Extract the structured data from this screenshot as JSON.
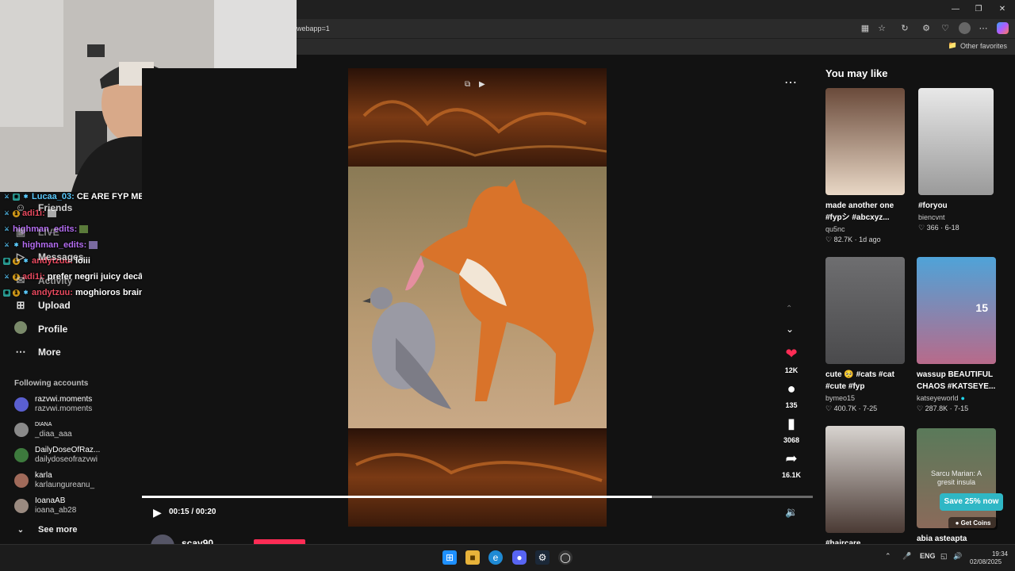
{
  "browser": {
    "address": "webapp=1",
    "other_favorites": "Other favorites"
  },
  "chat": [
    {
      "user": "Lucaa_03:",
      "text": "CE ARE FYP MEU",
      "user_color": "#5ac8fa"
    },
    {
      "user": "adi1i:",
      "text": "",
      "user_color": "#e84a5f"
    },
    {
      "user": "highman_edits:",
      "text": "",
      "user_color": "#b36cf0"
    },
    {
      "user": "highman_edits:",
      "text": "",
      "user_color": "#b36cf0"
    },
    {
      "user": "andytzuu:",
      "text": "loiii",
      "user_color": "#e84a5f"
    },
    {
      "user": "adi1i:",
      "text": "prefer negrii juicy decât asta",
      "user_color": "#e84a5f"
    },
    {
      "user": "andytzuu:",
      "text": "moghioros brainrot",
      "user_color": "#e84a5f"
    }
  ],
  "sidebar": {
    "nav": [
      {
        "label": "Friends",
        "icon": "friends-icon"
      },
      {
        "label": "LIVE",
        "icon": "live-icon"
      },
      {
        "label": "Messages",
        "icon": "messages-icon"
      },
      {
        "label": "Activity",
        "icon": "activity-icon"
      },
      {
        "label": "Upload",
        "icon": "upload-icon"
      },
      {
        "label": "Profile",
        "icon": "profile-avatar"
      },
      {
        "label": "More",
        "icon": "more-icon"
      }
    ],
    "following_title": "Following accounts",
    "following": [
      {
        "name": "razvwi.moments",
        "handle": "razvwi.moments",
        "color": "#5a5fd0"
      },
      {
        "name": "DIANA",
        "handle": "_diaa_aaa",
        "color": "#8a8a8a"
      },
      {
        "name": "DailyDoseOfRaz...",
        "handle": "dailydoseofrazvwi",
        "color": "#3d7a3d"
      },
      {
        "name": "karla",
        "handle": "karlaungureanu_",
        "color": "#a06a5a"
      },
      {
        "name": "IoanaAB",
        "handle": "ioana_ab28",
        "color": "#9a8a80"
      }
    ],
    "see_more": "See more"
  },
  "player": {
    "time": "00:15 / 00:20",
    "progress": 0.76,
    "author_partial": "scav90",
    "actions": [
      {
        "icon": "heart-icon",
        "count": "12K",
        "color": "#fe2c55"
      },
      {
        "icon": "comment-icon",
        "count": "135",
        "color": "#ffffff"
      },
      {
        "icon": "bookmark-icon",
        "count": "3068",
        "color": "#ffffff"
      },
      {
        "icon": "share-icon",
        "count": "16.1K",
        "color": "#ffffff"
      }
    ]
  },
  "recommendations": {
    "title": "You may like",
    "cards": [
      {
        "title": "made another one #fypシ #abcxyz...",
        "author": "qu5nc",
        "likes": "82.7K",
        "date": "1d ago",
        "verified": false
      },
      {
        "title": "#foryou",
        "author": "biencvnt",
        "likes": "366",
        "date": "6-18",
        "verified": false
      },
      {
        "title": "cute 🥺 #cats #cat #cute #fyp",
        "author": "bymeo15",
        "likes": "400.7K",
        "date": "7-25",
        "verified": false
      },
      {
        "title": "wassup BEAUTIFUL CHAOS #KATSEYE...",
        "author": "katseyeworld",
        "likes": "287.8K",
        "date": "7-15",
        "verified": true
      },
      {
        "title": "#haircare",
        "author": "",
        "likes": "",
        "date": "",
        "verified": false
      },
      {
        "title": "abia asteapta",
        "author": "",
        "likes": "",
        "date": "",
        "verified": false
      }
    ],
    "thumb_caption_4": "15",
    "thumb_caption_6": "Sarcu Marian: A gresit insula",
    "save_button": "Save 25% now",
    "get_coins": "Get Coins"
  },
  "taskbar": {
    "lang": "ENG",
    "time": "19:34",
    "date": "02/08/2025"
  }
}
